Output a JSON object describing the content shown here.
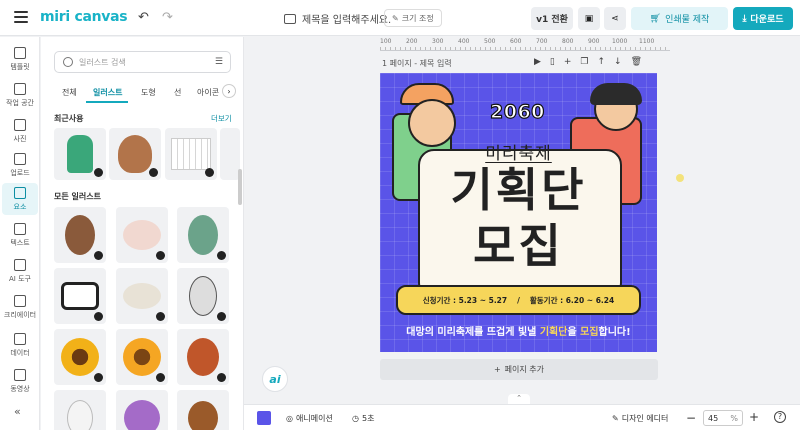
{
  "header": {
    "logo": "miri canvas",
    "doc_title_placeholder": "제목을 입력해주세요.",
    "resize_label": "크기 조정",
    "version_label": "v1 전환",
    "print_label": "인쇄물 제작",
    "download_label": "다운로드"
  },
  "rail": {
    "items": [
      {
        "label": "템플릿"
      },
      {
        "label": "작업 공간"
      },
      {
        "label": "사진"
      },
      {
        "label": "업로드"
      },
      {
        "label": "요소"
      },
      {
        "label": "텍스트"
      },
      {
        "label": "AI 도구"
      },
      {
        "label": "크리에이터"
      },
      {
        "label": "데이터"
      },
      {
        "label": "동영상"
      }
    ]
  },
  "panel": {
    "search_placeholder": "일러스트 검색",
    "tabs": [
      "전체",
      "일러스트",
      "도형",
      "선",
      "아이콘"
    ],
    "recent_title": "최근사용",
    "more_label": "더보기",
    "all_title": "모든 일러스트"
  },
  "canvas": {
    "ruler_ticks": [
      "100",
      "200",
      "300",
      "400",
      "500",
      "600",
      "700",
      "800",
      "900",
      "1000",
      "1100"
    ],
    "page_label": "1 페이지 - 제목 입력",
    "add_page_label": "페이지 추가"
  },
  "poster": {
    "year": "2060",
    "subtitle": "미리축제",
    "headline_1": "기획단",
    "headline_2": "모집",
    "apply_period": "신청기간 : 5.23 ~ 5.27",
    "activity_period": "활동기간 : 6.20 ~ 6.24",
    "bottom_pre": "대망의 미리축제를 뜨겁게 빛낼 ",
    "bottom_hl_1": "기획단",
    "bottom_mid": "을 ",
    "bottom_hl_2": "모집",
    "bottom_post": "합니다!",
    "bg_color": "#5a54e8"
  },
  "bottombar": {
    "animation_label": "애니메이션",
    "duration_label": "5초",
    "design_editor_label": "디자인 에디터",
    "zoom_value": "45",
    "zoom_unit": "%"
  },
  "ai_badge": "ai"
}
